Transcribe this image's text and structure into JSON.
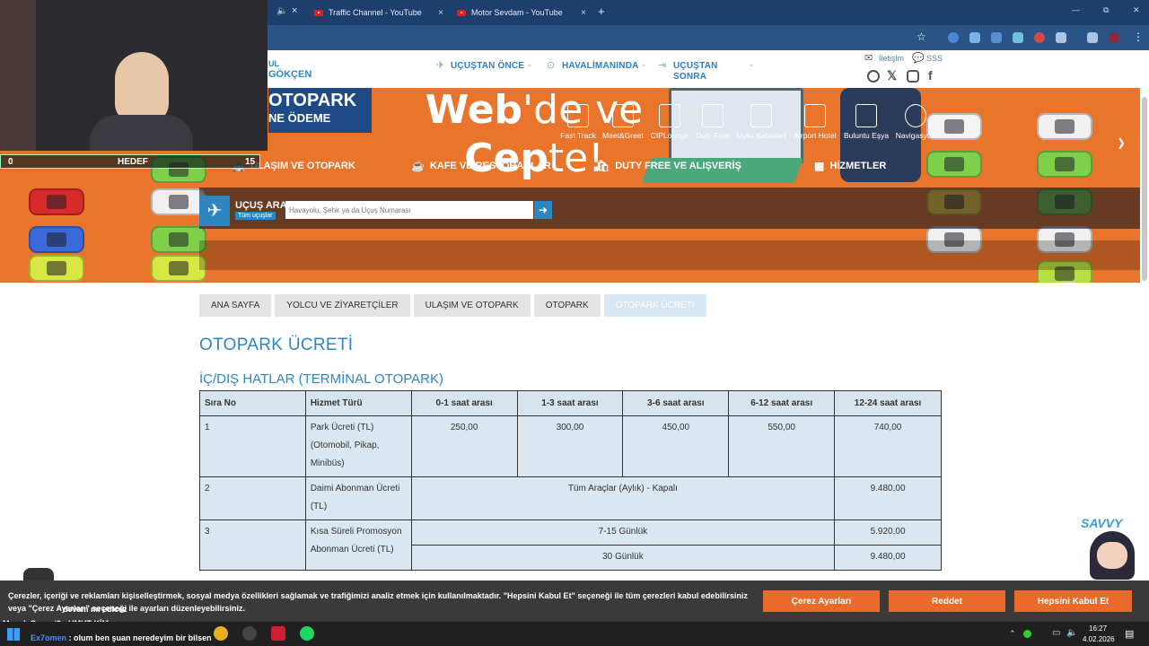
{
  "browser": {
    "tabs": [
      {
        "label": "Traffic Channel - YouTube"
      },
      {
        "label": "Motor Sevdam - YouTube"
      }
    ],
    "new_tab": "+",
    "tab_close": "×",
    "window_controls": {
      "minimize": "—",
      "maximize": "⧉",
      "close": "✕"
    }
  },
  "site": {
    "logo_text": "GÖKÇEN",
    "logo_small": "UL",
    "nav": [
      {
        "label": "UÇUŞTAN ÖNCE"
      },
      {
        "label": "HAVALİMANINDA"
      },
      {
        "label": "UÇUŞTAN"
      },
      {
        "label": "SONRA"
      }
    ],
    "top_links": {
      "contact": "İletişim",
      "faq": "SSS"
    }
  },
  "hero": {
    "headline_bold1": "Web",
    "headline_thin1": "'de ve",
    "headline_bold2": "Cep",
    "headline_thin2": "te!",
    "badge_line1": "OTOPARK",
    "badge_line2": "NE ÖDEME",
    "search_title": "UÇUŞ ARA",
    "search_sub": "Tüm uçuşlar",
    "search_placeholder": "Havayolu, Şehir ya da Uçuş Numarası",
    "services": [
      "Fast Track",
      "Meet&Greet",
      "CIPLounge",
      "Duty Free",
      "Uyku Kabinleri",
      "Airport Hotel",
      "Buluntu Eşya",
      "Navigasyon"
    ],
    "quick_links": [
      "ULAŞIM VE OTOPARK",
      "KAFE VE RESTORANLAR",
      "DUTY FREE VE ALIŞVERİŞ",
      "HİZMETLER"
    ]
  },
  "overlay": {
    "hedef_left": "0",
    "hedef_label": "HEDEF",
    "hedef_right": "15"
  },
  "breadcrumb": [
    "ANA SAYFA",
    "YOLCU VE ZİYARETÇİLER",
    "ULAŞIM VE OTOPARK",
    "OTOPARK",
    "OTOPARK ÜCRETİ"
  ],
  "page": {
    "title": "OTOPARK ÜCRETİ",
    "subtitle": "İÇ/DIŞ HATLAR (TERMİNAL OTOPARK)"
  },
  "table": {
    "headers": [
      "Sıra No",
      "Hizmet Türü",
      "0-1 saat arası",
      "1-3 saat arası",
      "3-6 saat arası",
      "6-12 saat arası",
      "12-24 saat arası"
    ],
    "row1": {
      "no": "1",
      "service": "Park Ücreti (TL) (Otomobil, Pikap, Minibüs)",
      "values": [
        "250,00",
        "300,00",
        "450,00",
        "550,00",
        "740,00"
      ]
    },
    "row2": {
      "no": "2",
      "service": "Daimi Abonman Ücreti (TL)",
      "desc": "Tüm Araçlar (Aylık) - Kapalı",
      "value": "9.480,00"
    },
    "row3": {
      "no": "3",
      "service": "Kısa Süreli Promosyon Abonman Ücreti (TL)",
      "desc1": "7-15 Günlük",
      "value1": "5.920,00",
      "desc2": "30 Günlük",
      "value2": "9.480,00"
    }
  },
  "cookie": {
    "text": "Çerezler, içeriği ve reklamları kişiselleştirmek, sosyal medya özellikleri sağlamak ve trafiğimizi analiz etmek için kullanılmaktadır. \"Hepsini Kabul Et\" seçeneği ile tüm çerezleri kabul edebilirsiniz veya \"Çerez Ayarları\" seçeneği ile ayarları düzenleyebilirsiniz.",
    "settings": "Çerez Ayarları",
    "reject": "Reddet",
    "accept": "Hepsini Kabul Et"
  },
  "chat": {
    "line1": "devam mı edicez",
    "line2": "MusalaCayani9 : UMUT KİM",
    "line3_user": "Ex7omen",
    "line3_text": ": olum ben şuan neredeyim bir bilsen"
  },
  "mascot": "SAVVY",
  "taskbar": {
    "time": "16:27",
    "date": "4.02.2026"
  },
  "colors": {
    "accent": "#2e86c1",
    "orange": "#ea6a2b",
    "navy": "#1c3f6e"
  }
}
